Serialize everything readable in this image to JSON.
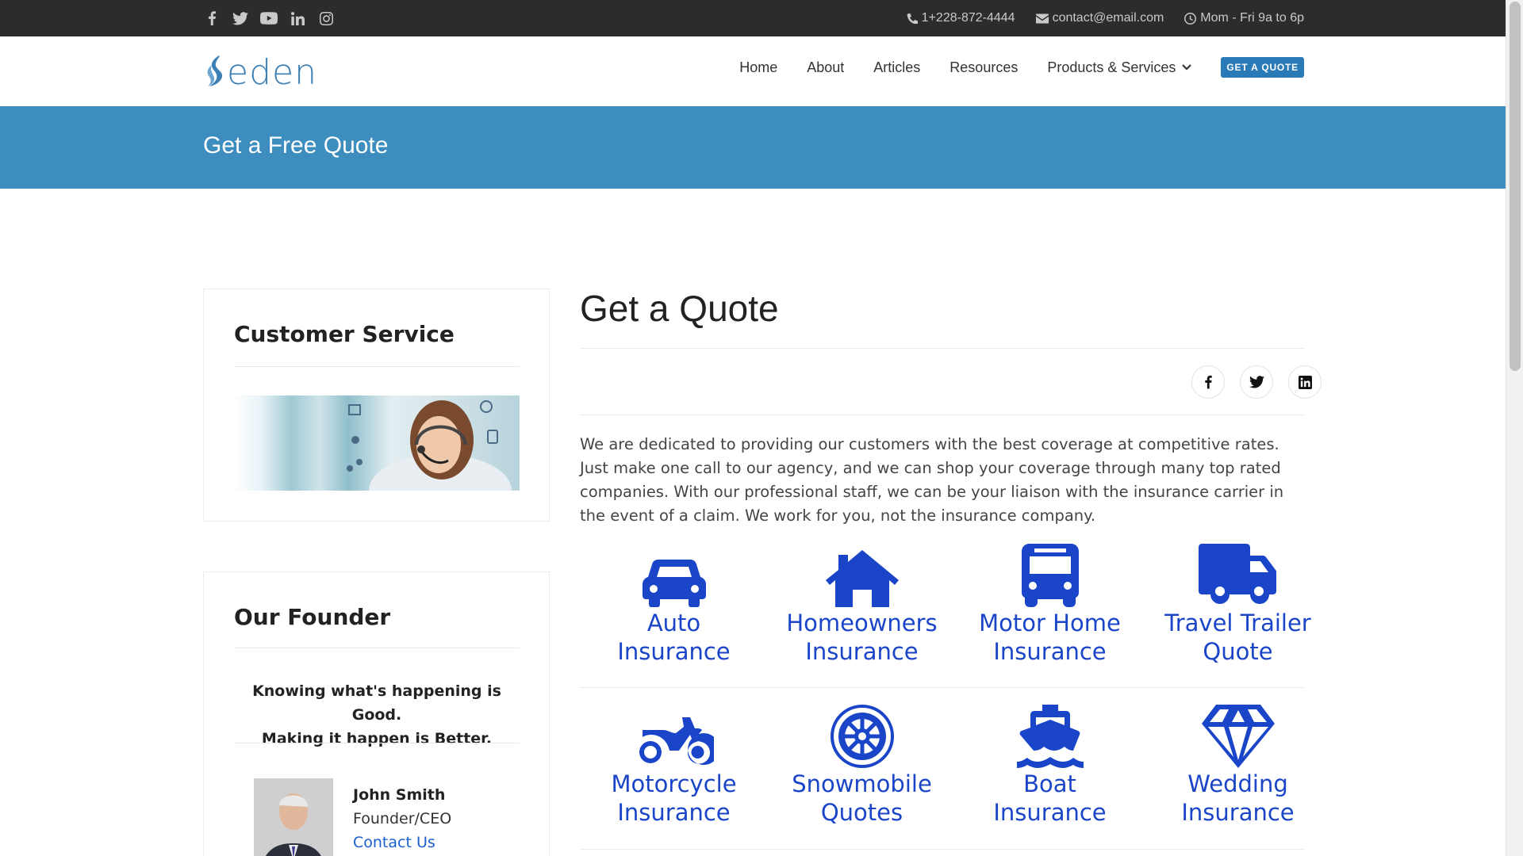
{
  "topbar": {
    "social_icons": [
      "facebook-icon",
      "twitter-icon",
      "youtube-icon",
      "linkedin-icon",
      "instagram-icon"
    ],
    "phone": "1+228-872-4444",
    "email": "contact@email.com",
    "hours": "Mom - Fri 9a to 6p"
  },
  "header": {
    "logo_text": "eden",
    "nav": {
      "home": "Home",
      "about": "About",
      "articles": "Articles",
      "resources": "Resources",
      "products": "Products & Services",
      "quote_button": "GET A QUOTE"
    }
  },
  "banner": {
    "title": "Get a Free Quote"
  },
  "sidebar": {
    "customer_service": {
      "title": "Customer Service"
    },
    "founder": {
      "title": "Our Founder",
      "quote_line1": "Knowing what's happening is Good.",
      "quote_line2": "Making it happen is Better.",
      "name": "John Smith",
      "role": "Founder/CEO",
      "link": "Contact Us"
    }
  },
  "main": {
    "title": "Get a Quote",
    "share_icons": [
      "facebook-icon",
      "twitter-icon",
      "linkedin-icon"
    ],
    "intro": "We are dedicated to providing our customers with the best coverage at competitive rates. Just make one call to our agency, and we can shop your coverage through many top rated companies. With our professional staff, we can be your liaison with the insurance carrier in the event of a claim. We work for you, not the insurance company.",
    "tiles": [
      {
        "line1": "Auto",
        "line2": "Insurance",
        "icon": "car-icon"
      },
      {
        "line1": "Homeowners",
        "line2": "Insurance",
        "icon": "home-icon"
      },
      {
        "line1": "Motor Home",
        "line2": "Insurance",
        "icon": "bus-icon"
      },
      {
        "line1": "Travel Trailer",
        "line2": "Quote",
        "icon": "truck-icon"
      },
      {
        "line1": "Motorcycle",
        "line2": "Insurance",
        "icon": "motorcycle-icon"
      },
      {
        "line1": "Snowmobile",
        "line2": "Quotes",
        "icon": "snowflake-wheel-icon"
      },
      {
        "line1": "Boat",
        "line2": "Insurance",
        "icon": "ship-icon"
      },
      {
        "line1": "Wedding",
        "line2": "Insurance",
        "icon": "diamond-icon"
      }
    ]
  },
  "colors": {
    "topbar": "#2c2c2c",
    "banner": "#3d8dbf",
    "accent": "#2a7ab8",
    "tile_blue": "#1a45c9"
  }
}
